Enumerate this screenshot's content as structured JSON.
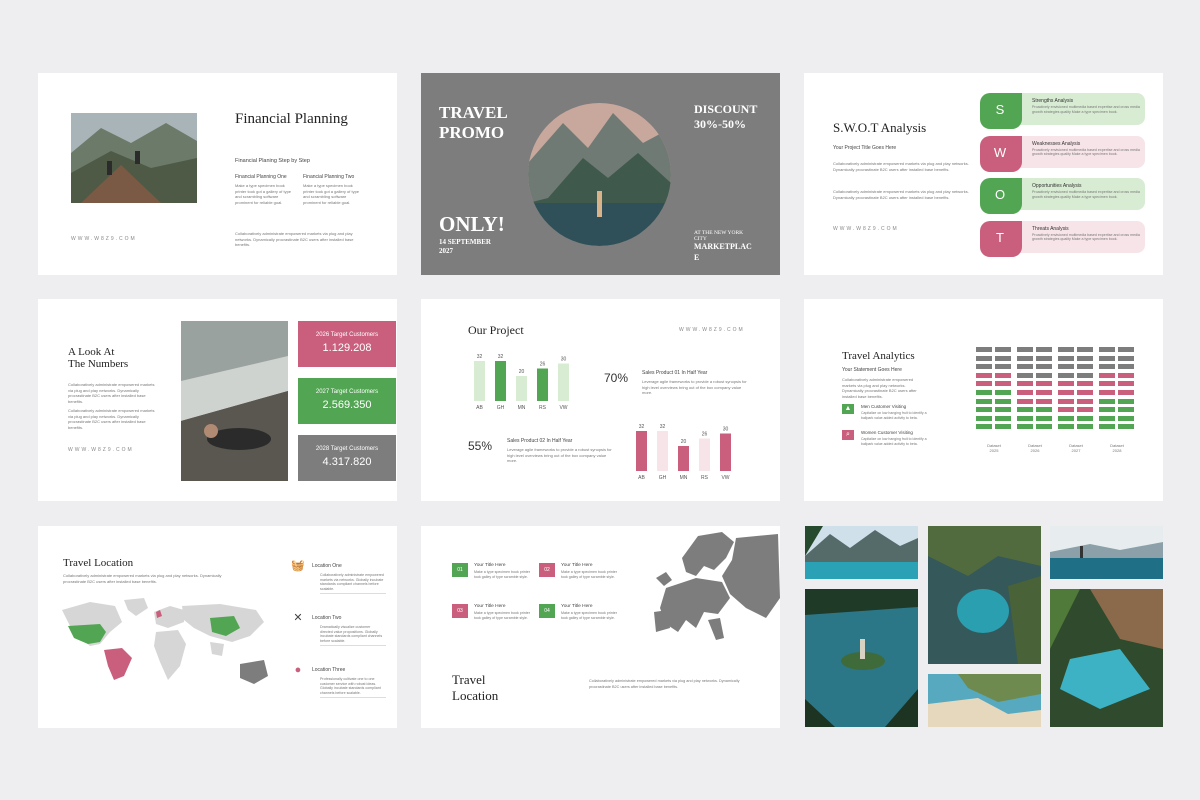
{
  "colors": {
    "green": "#52a552",
    "pink": "#c95f7d",
    "gray": "#7d7d7d",
    "light_green": "#d8ecd3",
    "light_pink": "#f7e4e8",
    "bg": "#eeeef0"
  },
  "website": "WWW.W8Z9.COM",
  "lorem": "Collaboratively administrate empowered markets via plug and play networks. Dynamically procrastinate B2C users after installed base benefits.",
  "financial": {
    "title": "Financial Planning",
    "subtitle": "Financial Planing Step by Step",
    "col1_title": "Financial Planning One",
    "col2_title": "Financial Planning Two",
    "col_text": "Make a type specimen book printer took got a gallery of type and scrambling software prominent for reliable goal."
  },
  "promo": {
    "title_line1": "TRAVEL",
    "title_line2": "PROMO",
    "discount_line1": "DISCOUNT",
    "discount_line2": "30%-50%",
    "only": "ONLY!",
    "date_line1": "14 SEPTEMBER",
    "date_line2": "2027",
    "venue_line1": "AT THE NEW YORK",
    "venue_line2": "CITY",
    "venue_line3": "MARKETPLAC",
    "venue_line4": "E"
  },
  "swot": {
    "title": "S.W.O.T Analysis",
    "subtitle": "Your Project Title Goes Here",
    "items": [
      {
        "letter": "S",
        "title": "Strengths Analysis",
        "text": "Proactively envisioned multimedia based expertise and cross media growth strategies quality Make a type specimen book."
      },
      {
        "letter": "W",
        "title": "Weaknesses Analysis",
        "text": "Proactively envisioned multimedia based expertise and cross media growth strategies quality Make a type specimen book."
      },
      {
        "letter": "O",
        "title": "Opportunities Analysis",
        "text": "Proactively envisioned multimedia based expertise and cross media growth strategies quality Make a type specimen book."
      },
      {
        "letter": "T",
        "title": "Threats Analysis",
        "text": "Proactively envisioned multimedia based expertise and cross media growth strategies quality Make a type specimen book."
      }
    ]
  },
  "numbers": {
    "title_line1": "A Look At",
    "title_line2": "The Numbers",
    "cards": [
      {
        "label": "2026 Target Customers",
        "value": "1.129.208"
      },
      {
        "label": "2027 Target Customers",
        "value": "2.569.350"
      },
      {
        "label": "2028 Target Customers",
        "value": "4.317.820"
      }
    ]
  },
  "project": {
    "title": "Our Project",
    "stat1_pct": "70%",
    "stat1_title": "Sales Product 01 In Half Year",
    "stat2_pct": "55%",
    "stat2_title": "Sales Product 02 In Half Year",
    "stat_text": "Leverage agile frameworks to provide a robust synopsis for high level overviews bring out of the box company value more."
  },
  "chart_data": [
    {
      "type": "bar",
      "categories": [
        "AB",
        "GH",
        "MN",
        "RS",
        "VW"
      ],
      "values": [
        32,
        32,
        20,
        26,
        30
      ],
      "series_colors": [
        "#d8ecd3",
        "#52a552",
        "#d8ecd3",
        "#52a552",
        "#d8ecd3"
      ]
    },
    {
      "type": "bar",
      "categories": [
        "AB",
        "GH",
        "MN",
        "RS",
        "VW"
      ],
      "values": [
        32,
        32,
        20,
        26,
        30
      ],
      "series_colors": [
        "#c95f7d",
        "#f7e4e8",
        "#c95f7d",
        "#f7e4e8",
        "#c95f7d"
      ]
    }
  ],
  "analytics": {
    "title": "Travel Analytics",
    "subtitle": "Your Statement Goes Here",
    "legend1_title": "Men Customer Visiting",
    "legend2_title": "Women Customer Visiting",
    "legend_text": "Capitalize on low hanging fruit to identify a ballpark value added activity to beta.",
    "years": [
      {
        "line1": "Dataset",
        "line2": "2025",
        "green": 5,
        "pink": 2
      },
      {
        "line1": "Dataset",
        "line2": "2026",
        "green": 3,
        "pink": 3
      },
      {
        "line1": "Dataset",
        "line2": "2027",
        "green": 2,
        "pink": 4
      },
      {
        "line1": "Dataset",
        "line2": "2028",
        "green": 4,
        "pink": 3
      }
    ]
  },
  "location": {
    "title": "Travel Location",
    "items": [
      {
        "title": "Location One",
        "icon": "basket-icon",
        "text": "Collaboratively administrate empowered markets via networks. Globally incubate standards compliant channels before scalable."
      },
      {
        "title": "Location Two",
        "icon": "cutlery-icon",
        "text": "Dramatically visualize customer directed value propositions. Globally incubate standards compliant channels before scalable."
      },
      {
        "title": "Location Three",
        "icon": "pin-icon",
        "text": "Professionally cultivate one to one customer service with robust ideas. Globally incubate standards compliant channels before scalable."
      }
    ]
  },
  "europe": {
    "title_line1": "Travel",
    "title_line2": "Location",
    "items": [
      {
        "num": "01",
        "title": "Your Title Here",
        "text": "Make a type specimen book printer took galley of type scramble style."
      },
      {
        "num": "02",
        "title": "Your Title Here",
        "text": "Make a type specimen book printer took galley of type scramble style."
      },
      {
        "num": "03",
        "title": "Your Title Here",
        "text": "Make a type specimen book printer took galley of type scramble style."
      },
      {
        "num": "04",
        "title": "Your Title Here",
        "text": "Make a type specimen book printer took galley of type scramble style."
      }
    ]
  }
}
